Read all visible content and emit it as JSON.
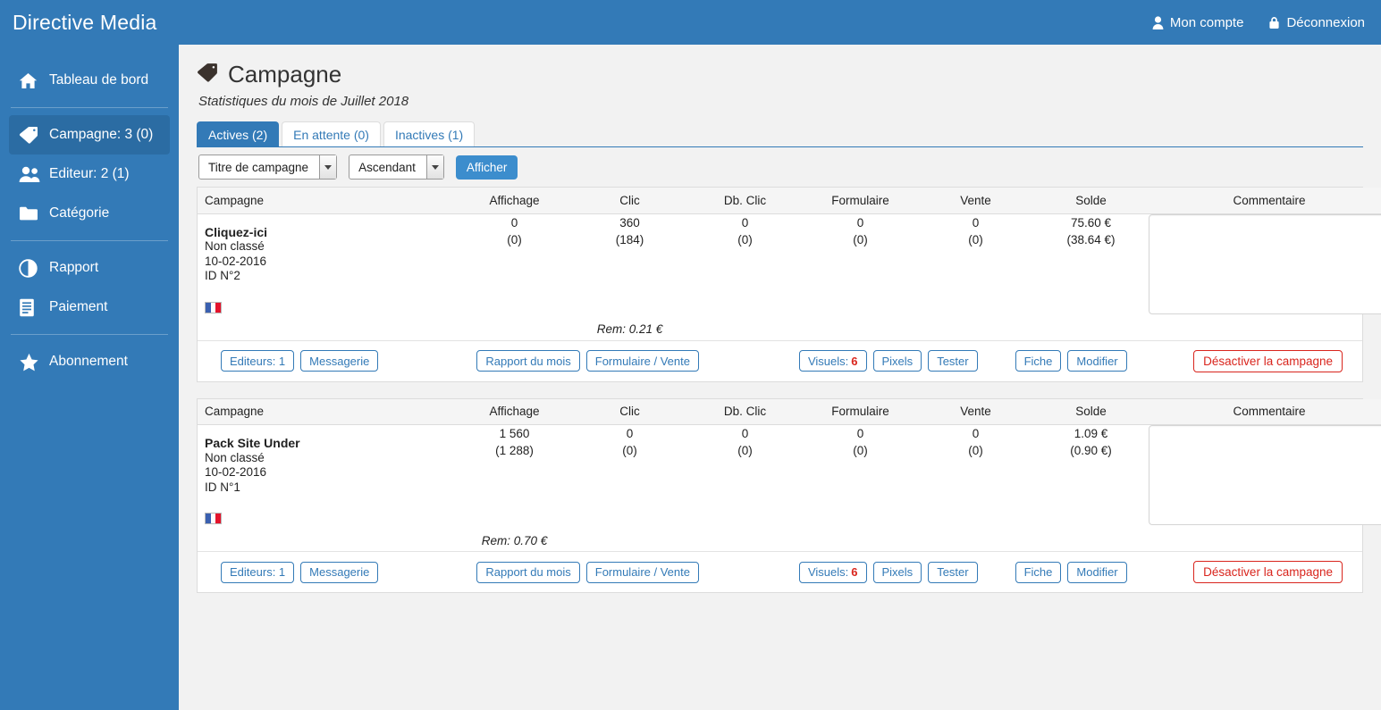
{
  "brand": "Directive Media",
  "topnav": [
    {
      "label": "Mon compte",
      "icon": "user-icon"
    },
    {
      "label": "Déconnexion",
      "icon": "lock-icon"
    }
  ],
  "sidebar": {
    "items": [
      {
        "label": "Tableau de bord",
        "icon": "home-icon",
        "active": false
      },
      {
        "label": "Campagne: 3 (0)",
        "icon": "tag-icon",
        "active": true
      },
      {
        "label": "Editeur: 2 (1)",
        "icon": "users-icon",
        "active": false
      },
      {
        "label": "Catégorie",
        "icon": "folder-icon",
        "active": false
      },
      {
        "label": "Rapport",
        "icon": "pie-chart-icon",
        "active": false
      },
      {
        "label": "Paiement",
        "icon": "document-icon",
        "active": false
      },
      {
        "label": "Abonnement",
        "icon": "star-icon",
        "active": false
      }
    ]
  },
  "page": {
    "title": "Campagne",
    "subtitle": "Statistiques du mois de Juillet 2018",
    "icon": "tag-icon"
  },
  "tabs": [
    {
      "label": "Actives (2)",
      "active": true
    },
    {
      "label": "En attente (0)",
      "active": false
    },
    {
      "label": "Inactives (1)",
      "active": false
    }
  ],
  "filters": {
    "sort_field": "Titre de campagne",
    "sort_order": "Ascendant",
    "submit_label": "Afficher"
  },
  "table": {
    "headers": [
      "Campagne",
      "Affichage",
      "Clic",
      "Db. Clic",
      "Formulaire",
      "Vente",
      "Solde",
      "Commentaire"
    ]
  },
  "actions": {
    "editeurs": "Editeurs: 1",
    "messagerie": "Messagerie",
    "rapport": "Rapport du mois",
    "formulaire_vente": "Formulaire / Vente",
    "visuels_label": "Visuels:",
    "visuels_count": "6",
    "pixels": "Pixels",
    "tester": "Tester",
    "fiche": "Fiche",
    "modifier": "Modifier",
    "desactiver": "Désactiver la campagne"
  },
  "campaigns": [
    {
      "title": "Cliquez-ici",
      "category": "Non classé",
      "date": "10-02-2016",
      "id": "ID N°2",
      "flag": "fr-flag-icon",
      "affichage": "0",
      "affichage_sub": "(0)",
      "clic": "360",
      "clic_sub": "(184)",
      "dbclic": "0",
      "dbclic_sub": "(0)",
      "formulaire": "0",
      "formulaire_sub": "(0)",
      "vente": "0",
      "vente_sub": "(0)",
      "solde": "75.60 €",
      "solde_sub": "(38.64 €)",
      "comment": "",
      "comment_placeholder": "",
      "rem": "Rem: 0.21 €",
      "rem_column": "clic"
    },
    {
      "title": "Pack Site Under",
      "category": "Non classé",
      "date": "10-02-2016",
      "id": "ID N°1",
      "flag": "fr-flag-icon",
      "affichage": "1 560",
      "affichage_sub": "(1 288)",
      "clic": "0",
      "clic_sub": "(0)",
      "dbclic": "0",
      "dbclic_sub": "(0)",
      "formulaire": "0",
      "formulaire_sub": "(0)",
      "vente": "0",
      "vente_sub": "(0)",
      "solde": "1.09 €",
      "solde_sub": "(0.90 €)",
      "comment": "",
      "comment_placeholder": "",
      "rem": "Rem: 0.70 €",
      "rem_column": "affichage"
    }
  ],
  "colors": {
    "brand_blue": "#337ab7",
    "active_blue": "#2b6ca3",
    "danger_red": "#d9251d",
    "page_bg": "#f2f2f2"
  }
}
